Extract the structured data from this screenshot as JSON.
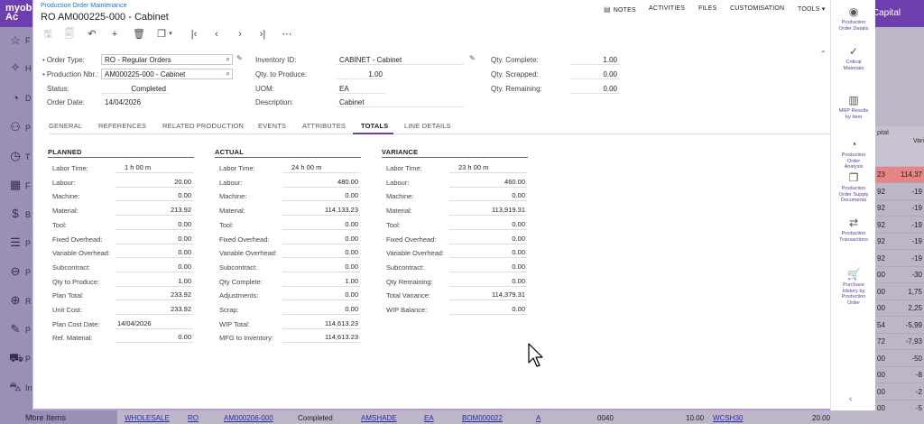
{
  "app": {
    "logo_line1": "myob",
    "logo_line2": "Ac",
    "company_fragment": "Capital",
    "nav_letters": [
      "F",
      "H",
      "D",
      "P",
      "T",
      "F",
      "B",
      "P",
      "P",
      "R",
      "P",
      "P",
      "In"
    ],
    "more_items": "More Items"
  },
  "window": {
    "breadcrumb": "Production Order Maintenance",
    "title": "RO AM000225-000 - Cabinet",
    "menu": [
      {
        "label": "NOTES",
        "icon": "notes-icon"
      },
      {
        "label": "ACTIVITIES"
      },
      {
        "label": "FILES"
      },
      {
        "label": "CUSTOMISATION"
      },
      {
        "label": "TOOLS ▾"
      }
    ]
  },
  "form": {
    "order_type": {
      "label": "Order Type:",
      "value": "RO - Regular Orders"
    },
    "production_nbr": {
      "label": "Production Nbr.:",
      "value": "AM000225-000 - Cabinet"
    },
    "status": {
      "label": "Status:",
      "value": "Completed"
    },
    "order_date": {
      "label": "Order Date:",
      "value": "14/04/2026"
    },
    "inventory_id": {
      "label": "Inventory ID:",
      "value": "CABINET - Cabinet"
    },
    "qty_to_produce": {
      "label": "Qty. to Produce:",
      "value": "1.00"
    },
    "uom": {
      "label": "UOM:",
      "value": "EA"
    },
    "description": {
      "label": "Description:",
      "value": "Cabinet"
    },
    "qty_complete": {
      "label": "Qty. Complete:",
      "value": "1.00"
    },
    "qty_scrapped": {
      "label": "Qty. Scrapped:",
      "value": "0.00"
    },
    "qty_remaining": {
      "label": "Qty. Remaining:",
      "value": "0.00"
    }
  },
  "tabs": [
    "GENERAL",
    "REFERENCES",
    "RELATED PRODUCTION",
    "EVENTS",
    "ATTRIBUTES",
    "TOTALS",
    "LINE DETAILS"
  ],
  "active_tab": "TOTALS",
  "totals": {
    "planned": {
      "title": "PLANNED",
      "rows": [
        {
          "label": "Labor Time:",
          "value": "1 h 00 m"
        },
        {
          "label": "Labour:",
          "value": "20.00"
        },
        {
          "label": "Machine:",
          "value": "0.00"
        },
        {
          "label": "Material:",
          "value": "213.92"
        },
        {
          "label": "Tool:",
          "value": "0.00"
        },
        {
          "label": "Fixed Overhead:",
          "value": "0.00"
        },
        {
          "label": "Variable Overhead:",
          "value": "0.00"
        },
        {
          "label": "Subcontract:",
          "value": "0.00"
        },
        {
          "label": "Qty to Produce:",
          "value": "1.00"
        },
        {
          "label": "Plan Total:",
          "value": "233.92"
        },
        {
          "label": "Unit Cost:",
          "value": "233.92"
        },
        {
          "label": "Plan Cost Date:",
          "value": "14/04/2026"
        },
        {
          "label": "Ref. Material:",
          "value": "0.00"
        }
      ]
    },
    "actual": {
      "title": "ACTUAL",
      "rows": [
        {
          "label": "Labor Time:",
          "value": "24 h 00 m"
        },
        {
          "label": "Labour:",
          "value": "480.00"
        },
        {
          "label": "Machine:",
          "value": "0.00"
        },
        {
          "label": "Material:",
          "value": "114,133.23"
        },
        {
          "label": "Tool:",
          "value": "0.00"
        },
        {
          "label": "Fixed Overhead:",
          "value": "0.00"
        },
        {
          "label": "Variable Overhead:",
          "value": "0.00"
        },
        {
          "label": "Subcontract:",
          "value": "0.00"
        },
        {
          "label": "Qty Complete:",
          "value": "1.00"
        },
        {
          "label": "Adjustments:",
          "value": "0.00"
        },
        {
          "label": "Scrap:",
          "value": "0.00"
        },
        {
          "label": "WIP Total:",
          "value": "114,613.23"
        },
        {
          "label": "MFG to Inventory:",
          "value": "114,613.23"
        }
      ]
    },
    "variance": {
      "title": "VARIANCE",
      "rows": [
        {
          "label": "Labor Time:",
          "value": "23 h 00 m"
        },
        {
          "label": "Labour:",
          "value": "460.00"
        },
        {
          "label": "Machine:",
          "value": "0.00"
        },
        {
          "label": "Material:",
          "value": "113,919.31"
        },
        {
          "label": "Tool:",
          "value": "0.00"
        },
        {
          "label": "Fixed Overhead:",
          "value": "0.00"
        },
        {
          "label": "Variable Overhead:",
          "value": "0.00"
        },
        {
          "label": "Subcontract:",
          "value": "0.00"
        },
        {
          "label": "Qty Remaining:",
          "value": "0.00"
        },
        {
          "label": "Total Variance:",
          "value": "114,379.31"
        },
        {
          "label": "WIP Balance:",
          "value": "0.00"
        }
      ]
    }
  },
  "side_panel": [
    {
      "label": "Production\nOrder Details",
      "icon": "eye-icon"
    },
    {
      "label": "Critical\nMaterials",
      "icon": "check-circle-icon"
    },
    {
      "label": "MRP Results\nby Item",
      "icon": "chart-icon"
    },
    {
      "label": "Production\nOrder\nAnalysis",
      "icon": "gauge-icon"
    },
    {
      "label": "Production\nOrder Supply\nDocuments",
      "icon": "documents-icon"
    },
    {
      "label": "Production\nTransactions",
      "icon": "swap-icon"
    },
    {
      "label": "Purchase\nHistory by\nProduction\nOrder",
      "icon": "cart-icon"
    }
  ],
  "background_grid": {
    "header_a": "pital",
    "header_b": "Vari",
    "rows": [
      {
        "a": "23",
        "b": "114,37",
        "highlight": true
      },
      {
        "a": "92",
        "b": "-19"
      },
      {
        "a": "92",
        "b": "-19"
      },
      {
        "a": "92",
        "b": "-19"
      },
      {
        "a": "92",
        "b": "-19"
      },
      {
        "a": "92",
        "b": "-19"
      },
      {
        "a": "00",
        "b": "-30"
      },
      {
        "a": "00",
        "b": "1,75"
      },
      {
        "a": "00",
        "b": "2,25"
      },
      {
        "a": "54",
        "b": "-5,99"
      },
      {
        "a": "72",
        "b": "-7,93"
      },
      {
        "a": "00",
        "b": "-50"
      },
      {
        "a": "00",
        "b": "-8"
      },
      {
        "a": "00",
        "b": "-2"
      },
      {
        "a": "00",
        "b": "-5"
      }
    ],
    "bottom": [
      "WHOLESALE",
      "RO",
      "AM000206-000",
      "Completed",
      "AMSHADE",
      "EA",
      "BOM000022",
      "A",
      "0040",
      "10.00",
      "WCSH30",
      "20.00"
    ]
  }
}
